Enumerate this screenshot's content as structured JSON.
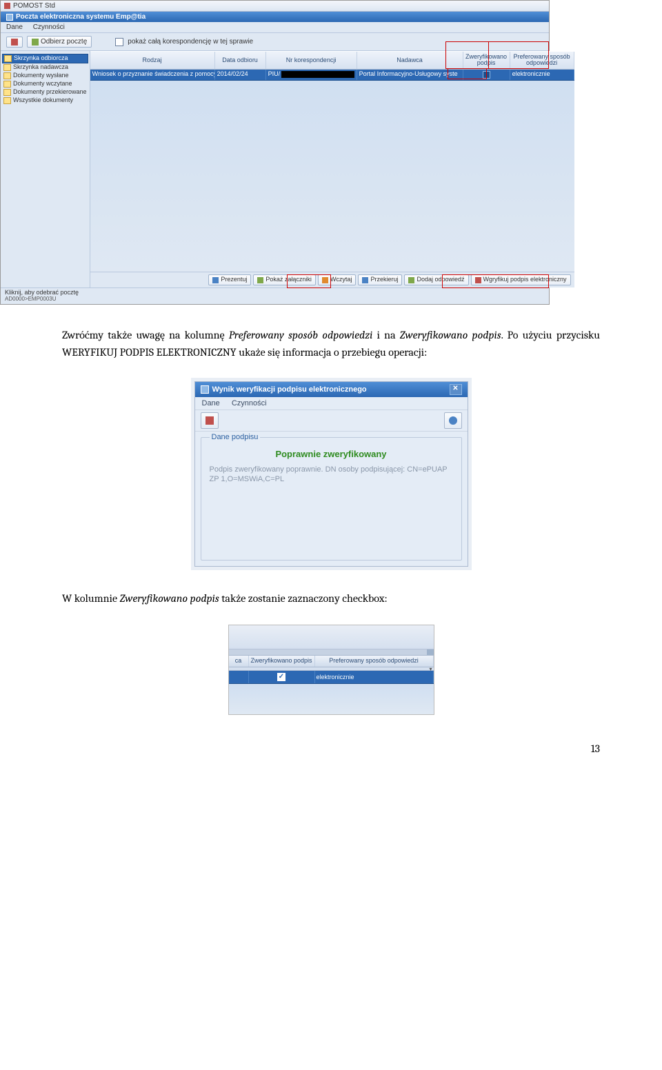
{
  "shot1": {
    "titlebar": "POMOST Std",
    "subtitle": "Poczta elektroniczna systemu Emp@tia",
    "menu": [
      "Dane",
      "Czynności"
    ],
    "toolbar": {
      "get_mail": "Odbierz pocztę",
      "chk_label": "pokaż całą korespondencję w tej sprawie"
    },
    "tree": [
      "Skrzynka odbiorcza",
      "Skrzynka nadawcza",
      "Dokumenty wysłane",
      "Dokumenty wczytane",
      "Dokumenty przekierowane",
      "Wszystkie dokumenty"
    ],
    "columns": {
      "rodzaj": "Rodzaj",
      "data": "Data odbioru",
      "nr": "Nr korespondencji",
      "nadawca": "Nadawca",
      "zwer": "Zweryfikowano podpis",
      "pref": "Preferowany sposób odpowiedzi"
    },
    "row": {
      "rodzaj": "Wniosek o przyznanie świadczenia z pomocy społecznej",
      "data": "2014/02/24",
      "nr": "PIU/",
      "nadawca": "Portal Informacyjno-Usługowy syste",
      "pref": "elektronicznie"
    },
    "actions": {
      "prezentuj": "Prezentuj",
      "pokaz": "Pokaż załączniki",
      "wczytaj": "Wczytaj",
      "przekieruj": "Przekieruj",
      "dodaj": "Dodaj odpowiedź",
      "weryf": "Wgryfikuj podpis elektroniczny"
    },
    "status1": "Kliknij, aby odebrać pocztę",
    "status2": "AD0000>EMP0003U"
  },
  "para1_pre": "Zwróćmy także uwagę na kolumnę ",
  "para1_it1": "Preferowany sposób odpowiedzi",
  "para1_mid": " i na ",
  "para1_it2": "Zweryfikowano podpis",
  "para1_post": ". Po użyciu przycisku WERYFIKUJ PODPIS ELEKTRONICZNY ukaże się informacja o przebiegu operacji:",
  "shot2": {
    "title": "Wynik weryfikacji podpisu elektronicznego",
    "menu": [
      "Dane",
      "Czynności"
    ],
    "legend": "Dane podpisu",
    "ok": "Poprawnie zweryfikowany",
    "desc": "Podpis zweryfikowany poprawnie. DN osoby podpisującej: CN=ePUAP ZP 1,O=MSWiA,C=PL"
  },
  "para2_pre": "W kolumnie ",
  "para2_it": "Zweryfikowano podpis",
  "para2_post": " także zostanie zaznaczony checkbox:",
  "shot3": {
    "ca": "ca",
    "zwer": "Zweryfikowano podpis",
    "pref": "Preferowany sposób odpowiedzi",
    "val": "elektronicznie"
  },
  "pagenum": "13"
}
